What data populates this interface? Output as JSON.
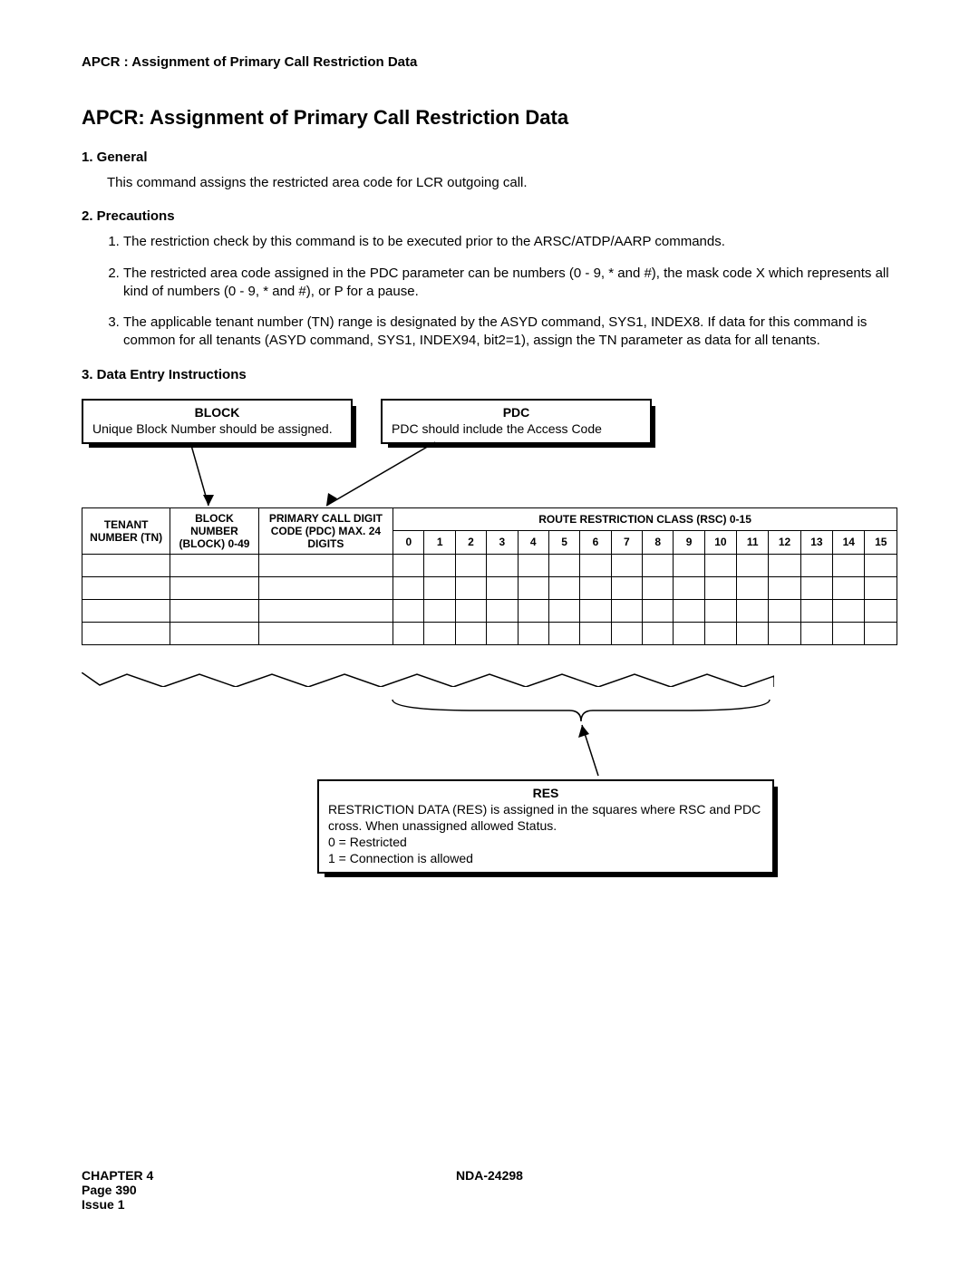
{
  "running_header": "APCR : Assignment of Primary Call Restriction Data",
  "title": "APCR: Assignment of Primary Call Restriction Data",
  "sections": {
    "general": {
      "head": "1.  General",
      "body": "This command assigns the restricted area code for LCR outgoing call."
    },
    "precautions": {
      "head": "2.  Precautions",
      "items": [
        "The restriction check by this command is to be executed prior to the ARSC/ATDP/AARP commands.",
        "The restricted area code assigned in the PDC parameter can be numbers (0 - 9, * and #), the mask code  X  which represents all kind of numbers (0 - 9, * and #), or  P  for a pause.",
        "The applicable tenant number (TN) range is designated by the ASYD command, SYS1, INDEX8. If data for this command is common for all tenants (ASYD command, SYS1, INDEX94, bit2=1), assign the TN parameter as data  for all tenants."
      ]
    },
    "dei": {
      "head": "3.  Data Entry Instructions"
    }
  },
  "callouts": {
    "block": {
      "title": "BLOCK",
      "body": "Unique Block Number should be assigned."
    },
    "pdc": {
      "title": "PDC",
      "body": "PDC should include the Access Code"
    },
    "res": {
      "title": "RES",
      "line1": "RESTRICTION DATA (RES)  is assigned in the squares where RSC and PDC cross.  When unassigned allowed Status.",
      "line2": "0 = Restricted",
      "line3": "1 = Connection is allowed"
    }
  },
  "table": {
    "headers": {
      "tn": "TENANT NUMBER (TN)",
      "blk": "BLOCK NUMBER (BLOCK) 0-49",
      "pdc": "PRIMARY CALL DIGIT CODE (PDC) MAX. 24 DIGITS",
      "rsc": "ROUTE RESTRICTION CLASS (RSC) 0-15"
    },
    "rsc_nums": [
      "0",
      "1",
      "2",
      "3",
      "4",
      "5",
      "6",
      "7",
      "8",
      "9",
      "10",
      "11",
      "12",
      "13",
      "14",
      "15"
    ]
  },
  "footer": {
    "chapter": "CHAPTER 4",
    "page": "Page 390",
    "issue": "Issue 1",
    "docnum": "NDA-24298"
  }
}
